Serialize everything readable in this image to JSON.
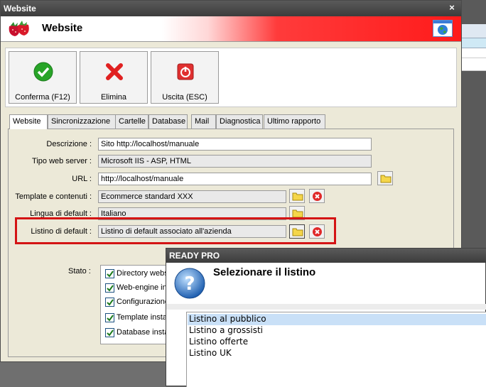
{
  "window": {
    "title": "Website",
    "close": "×"
  },
  "header": {
    "title": "Website"
  },
  "toolbar": {
    "confirm": "Conferma (F12)",
    "delete": "Elimina",
    "exit": "Uscita (ESC)"
  },
  "tabs": [
    "Website",
    "Sincronizzazione",
    "Cartelle",
    "Database",
    "Mail",
    "Diagnostica",
    "Ultimo rapporto"
  ],
  "form": {
    "descrizione": {
      "label": "Descrizione :",
      "value": "Sito http://localhost/manuale"
    },
    "tipo": {
      "label": "Tipo web server :",
      "value": "Microsoft IIS - ASP, HTML"
    },
    "url": {
      "label": "URL :",
      "value": "http://localhost/manuale"
    },
    "template": {
      "label": "Template e contenuti :",
      "value": "Ecommerce standard XXX"
    },
    "lingua": {
      "label": "Lingua di default :",
      "value": "Italiano"
    },
    "listino": {
      "label": "Listino di default :",
      "value": "Listino di default associato all'azienda"
    }
  },
  "stato": {
    "label": "Stato :",
    "items": [
      "Directory webs",
      "Web-engine in",
      "Configurazione",
      "Template insta",
      "Database insta"
    ]
  },
  "dialog": {
    "title": "READY PRO",
    "heading": "Selezionare il listino",
    "items": [
      "Listino al pubblico",
      "Listino a grossisti",
      "Listino offerte",
      "Listino UK"
    ]
  },
  "colors": {
    "title_bar": "#4a4a4a",
    "accent_red": "#d41414",
    "selection": "#c9e0f7"
  }
}
